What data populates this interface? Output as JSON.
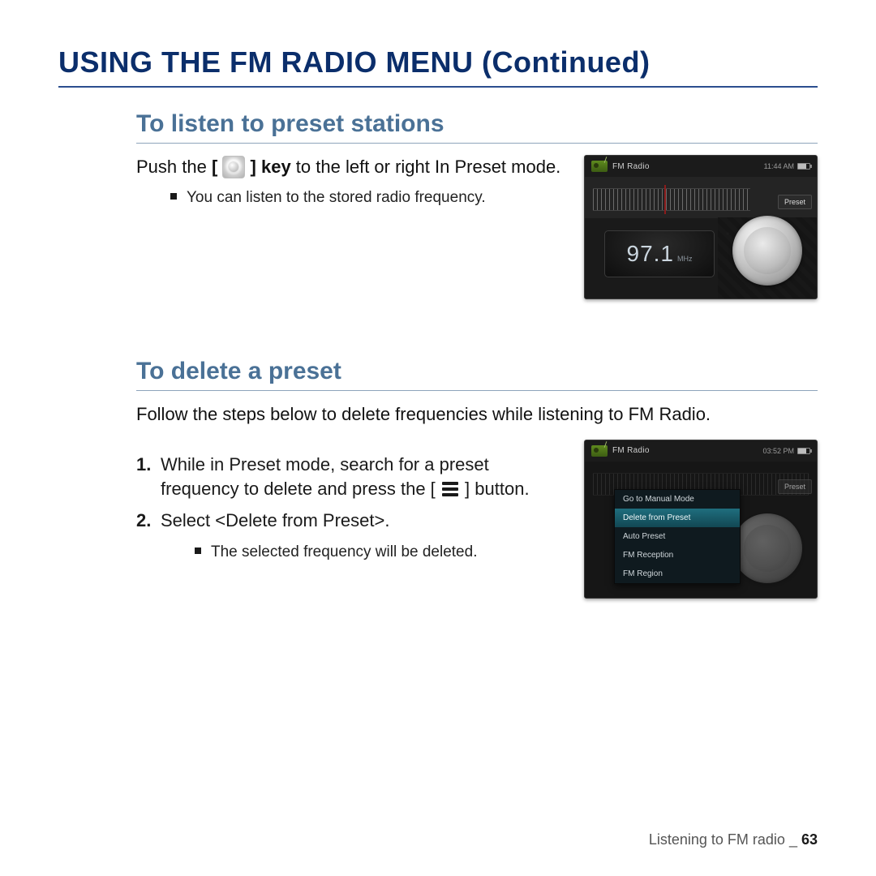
{
  "page": {
    "title": "USING THE FM RADIO MENU (Continued)",
    "footer_text": "Listening to FM radio _ ",
    "footer_page": "63"
  },
  "section1": {
    "title": "To listen to preset stations",
    "para_pre": "Push the ",
    "para_open_br": "[",
    "para_close_br": "]",
    "para_key_label": " key",
    "para_post": " to the left or right In Preset mode.",
    "bullet1": "You can listen to the stored radio frequency."
  },
  "section2": {
    "title": "To delete a preset",
    "lead": "Follow the steps below to delete frequencies while listening to FM Radio.",
    "step1_a": "While in Preset mode, search for a preset frequency to delete and press the ",
    "step1_open_br": "[",
    "step1_close_br": "]",
    "step1_button": " button",
    "step1_end": ".",
    "step2_a": "Select ",
    "step2_bold": "<Delete from Preset>",
    "step2_end": ".",
    "sub_bullet": "The selected frequency will be deleted."
  },
  "shot1": {
    "header": "FM Radio",
    "clock": "11:44 AM",
    "preset": "Preset",
    "freq": "97.1",
    "unit": "MHz"
  },
  "shot2": {
    "header": "FM Radio",
    "clock": "03:52 PM",
    "preset": "Preset",
    "m1": "Go to Manual Mode",
    "m2": "Delete from Preset",
    "m3": "Auto Preset",
    "m4": "FM Reception",
    "m5": "FM Region"
  }
}
